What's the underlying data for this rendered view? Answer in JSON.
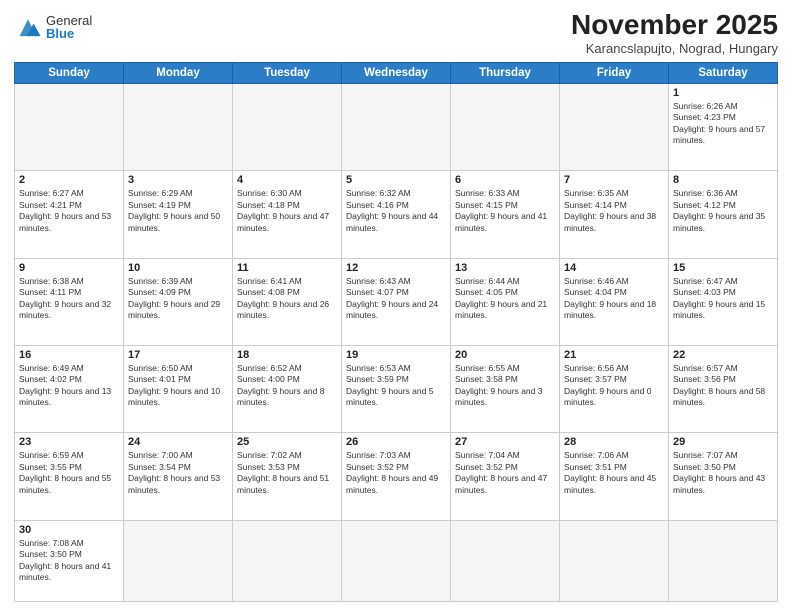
{
  "header": {
    "logo_general": "General",
    "logo_blue": "Blue",
    "month_title": "November 2025",
    "subtitle": "Karancslapujto, Nograd, Hungary"
  },
  "days_of_week": [
    "Sunday",
    "Monday",
    "Tuesday",
    "Wednesday",
    "Thursday",
    "Friday",
    "Saturday"
  ],
  "weeks": [
    [
      {
        "day": "",
        "empty": true
      },
      {
        "day": "",
        "empty": true
      },
      {
        "day": "",
        "empty": true
      },
      {
        "day": "",
        "empty": true
      },
      {
        "day": "",
        "empty": true
      },
      {
        "day": "",
        "empty": true
      },
      {
        "day": "1",
        "sunrise": "6:26 AM",
        "sunset": "4:23 PM",
        "daylight": "9 hours and 57 minutes."
      }
    ],
    [
      {
        "day": "2",
        "sunrise": "6:27 AM",
        "sunset": "4:21 PM",
        "daylight": "9 hours and 53 minutes."
      },
      {
        "day": "3",
        "sunrise": "6:29 AM",
        "sunset": "4:19 PM",
        "daylight": "9 hours and 50 minutes."
      },
      {
        "day": "4",
        "sunrise": "6:30 AM",
        "sunset": "4:18 PM",
        "daylight": "9 hours and 47 minutes."
      },
      {
        "day": "5",
        "sunrise": "6:32 AM",
        "sunset": "4:16 PM",
        "daylight": "9 hours and 44 minutes."
      },
      {
        "day": "6",
        "sunrise": "6:33 AM",
        "sunset": "4:15 PM",
        "daylight": "9 hours and 41 minutes."
      },
      {
        "day": "7",
        "sunrise": "6:35 AM",
        "sunset": "4:14 PM",
        "daylight": "9 hours and 38 minutes."
      },
      {
        "day": "8",
        "sunrise": "6:36 AM",
        "sunset": "4:12 PM",
        "daylight": "9 hours and 35 minutes."
      }
    ],
    [
      {
        "day": "9",
        "sunrise": "6:38 AM",
        "sunset": "4:11 PM",
        "daylight": "9 hours and 32 minutes."
      },
      {
        "day": "10",
        "sunrise": "6:39 AM",
        "sunset": "4:09 PM",
        "daylight": "9 hours and 29 minutes."
      },
      {
        "day": "11",
        "sunrise": "6:41 AM",
        "sunset": "4:08 PM",
        "daylight": "9 hours and 26 minutes."
      },
      {
        "day": "12",
        "sunrise": "6:43 AM",
        "sunset": "4:07 PM",
        "daylight": "9 hours and 24 minutes."
      },
      {
        "day": "13",
        "sunrise": "6:44 AM",
        "sunset": "4:05 PM",
        "daylight": "9 hours and 21 minutes."
      },
      {
        "day": "14",
        "sunrise": "6:46 AM",
        "sunset": "4:04 PM",
        "daylight": "9 hours and 18 minutes."
      },
      {
        "day": "15",
        "sunrise": "6:47 AM",
        "sunset": "4:03 PM",
        "daylight": "9 hours and 15 minutes."
      }
    ],
    [
      {
        "day": "16",
        "sunrise": "6:49 AM",
        "sunset": "4:02 PM",
        "daylight": "9 hours and 13 minutes."
      },
      {
        "day": "17",
        "sunrise": "6:50 AM",
        "sunset": "4:01 PM",
        "daylight": "9 hours and 10 minutes."
      },
      {
        "day": "18",
        "sunrise": "6:52 AM",
        "sunset": "4:00 PM",
        "daylight": "9 hours and 8 minutes."
      },
      {
        "day": "19",
        "sunrise": "6:53 AM",
        "sunset": "3:59 PM",
        "daylight": "9 hours and 5 minutes."
      },
      {
        "day": "20",
        "sunrise": "6:55 AM",
        "sunset": "3:58 PM",
        "daylight": "9 hours and 3 minutes."
      },
      {
        "day": "21",
        "sunrise": "6:56 AM",
        "sunset": "3:57 PM",
        "daylight": "9 hours and 0 minutes."
      },
      {
        "day": "22",
        "sunrise": "6:57 AM",
        "sunset": "3:56 PM",
        "daylight": "8 hours and 58 minutes."
      }
    ],
    [
      {
        "day": "23",
        "sunrise": "6:59 AM",
        "sunset": "3:55 PM",
        "daylight": "8 hours and 55 minutes."
      },
      {
        "day": "24",
        "sunrise": "7:00 AM",
        "sunset": "3:54 PM",
        "daylight": "8 hours and 53 minutes."
      },
      {
        "day": "25",
        "sunrise": "7:02 AM",
        "sunset": "3:53 PM",
        "daylight": "8 hours and 51 minutes."
      },
      {
        "day": "26",
        "sunrise": "7:03 AM",
        "sunset": "3:52 PM",
        "daylight": "8 hours and 49 minutes."
      },
      {
        "day": "27",
        "sunrise": "7:04 AM",
        "sunset": "3:52 PM",
        "daylight": "8 hours and 47 minutes."
      },
      {
        "day": "28",
        "sunrise": "7:06 AM",
        "sunset": "3:51 PM",
        "daylight": "8 hours and 45 minutes."
      },
      {
        "day": "29",
        "sunrise": "7:07 AM",
        "sunset": "3:50 PM",
        "daylight": "8 hours and 43 minutes."
      }
    ],
    [
      {
        "day": "30",
        "sunrise": "7:08 AM",
        "sunset": "3:50 PM",
        "daylight": "8 hours and 41 minutes."
      },
      {
        "day": "",
        "empty": true
      },
      {
        "day": "",
        "empty": true
      },
      {
        "day": "",
        "empty": true
      },
      {
        "day": "",
        "empty": true
      },
      {
        "day": "",
        "empty": true
      },
      {
        "day": "",
        "empty": true
      }
    ]
  ]
}
